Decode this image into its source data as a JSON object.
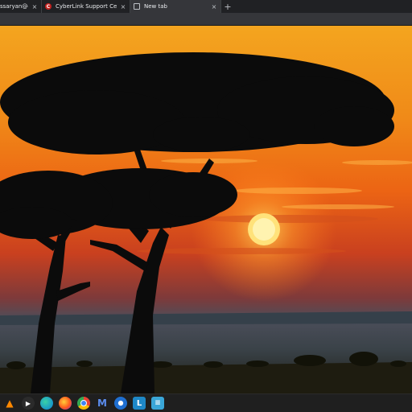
{
  "tabs": [
    {
      "title": "ssaryan@ot",
      "favicon": "mail-icon",
      "active": false
    },
    {
      "title": "CyberLink Support Center",
      "favicon": "cyberlink-icon",
      "active": false
    },
    {
      "title": "New tab",
      "favicon": "newtab-icon",
      "active": true
    }
  ],
  "tab_close_glyph": "×",
  "new_tab_glyph": "+",
  "wallpaper": {
    "description_icon": "sunset-acacia-wallpaper",
    "colors": {
      "sky_top": "#f29a1c",
      "sky_mid": "#ee5f14",
      "sky_low": "#b3362a",
      "haze": "#4a5260",
      "ground": "#222010",
      "sun": "#ffd54a"
    }
  },
  "taskbar": {
    "icons": [
      {
        "name": "vlc-icon",
        "glyph": "▲"
      },
      {
        "name": "media-player-icon",
        "glyph": "▶"
      },
      {
        "name": "edge-icon",
        "glyph": ""
      },
      {
        "name": "firefox-icon",
        "glyph": ""
      },
      {
        "name": "chrome-icon",
        "glyph": ""
      },
      {
        "name": "malwarebytes-icon",
        "glyph": "M"
      },
      {
        "name": "cyberlink-icon",
        "glyph": ""
      },
      {
        "name": "launcher-icon",
        "glyph": "L"
      },
      {
        "name": "notepad-icon",
        "glyph": "≡"
      }
    ]
  }
}
